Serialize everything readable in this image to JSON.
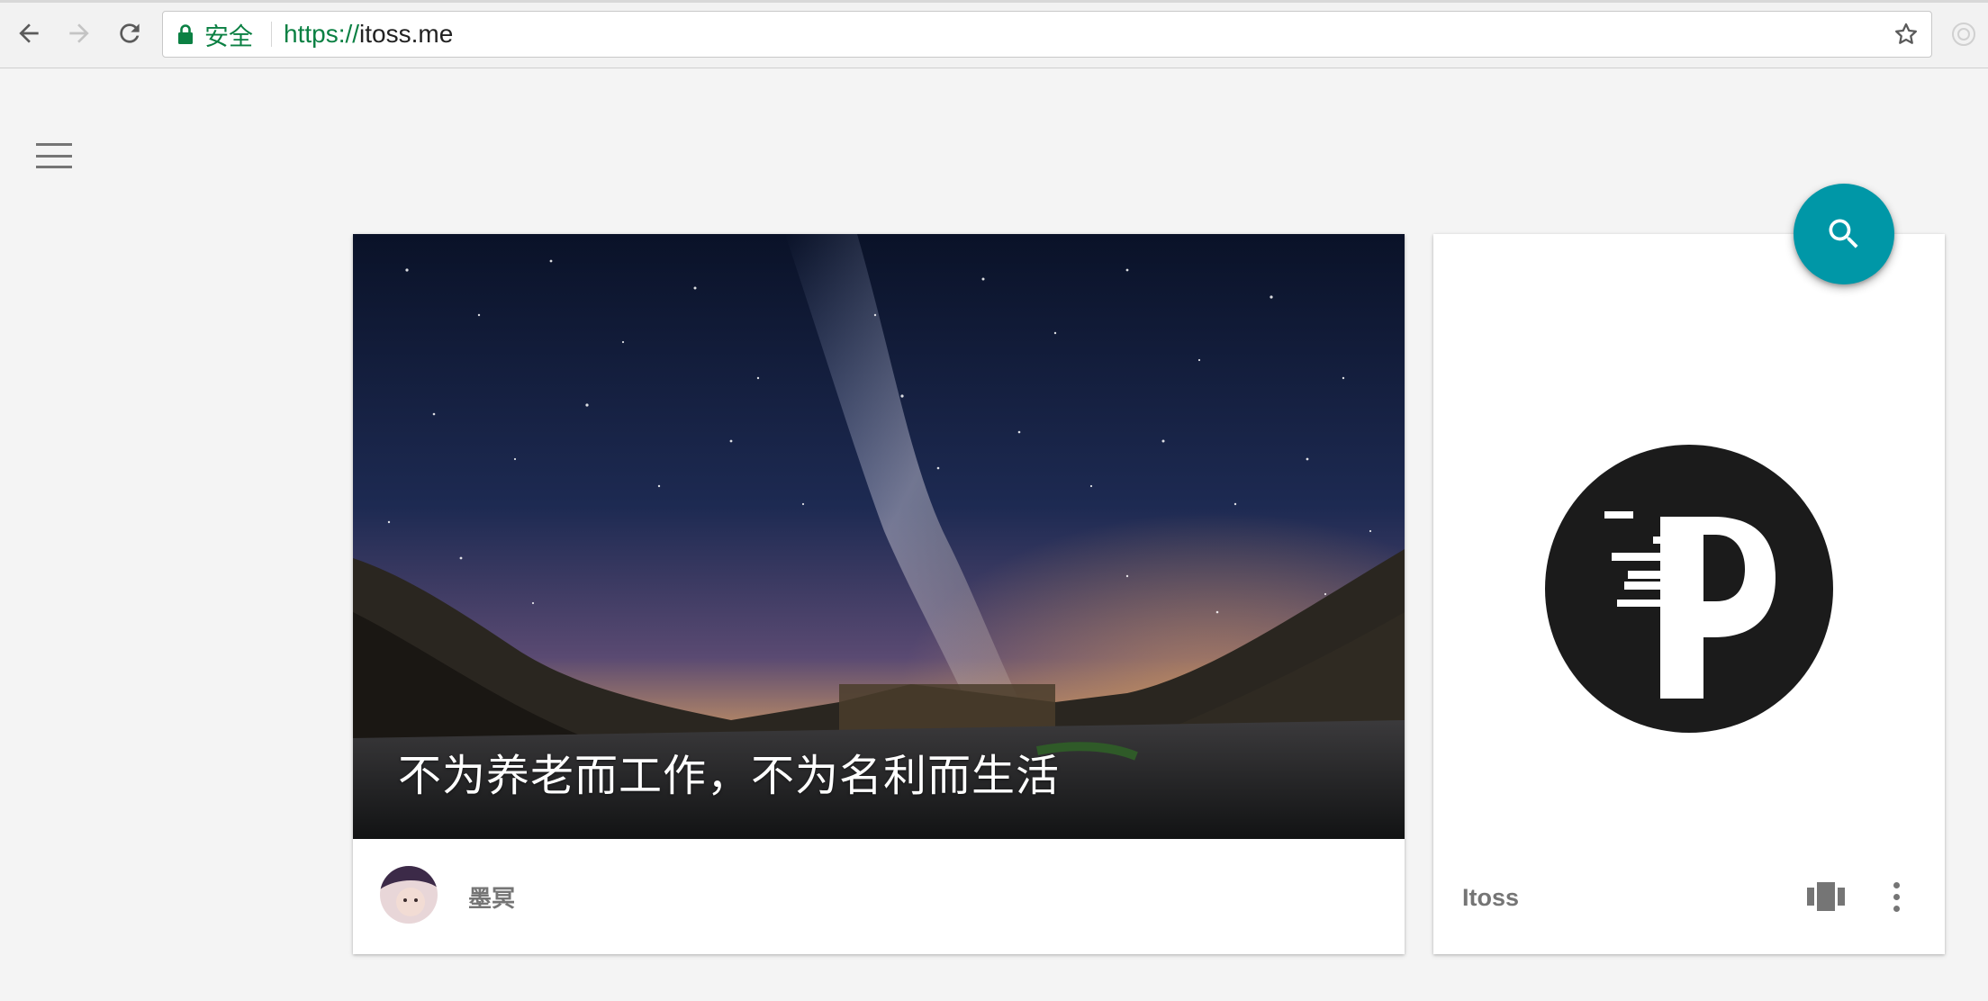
{
  "browser": {
    "secure_label": "安全",
    "url_scheme": "https://",
    "url_host": "itoss.me",
    "icons": [
      "back-icon",
      "forward-icon",
      "reload-icon",
      "lock-icon",
      "star-icon",
      "extension-icon"
    ],
    "secure_color": "#0b8043"
  },
  "page": {
    "menu_icon": "hamburger-menu-icon",
    "fab_icon": "search-icon",
    "fab_color": "#0097a7",
    "main_card": {
      "title": "不为养老而工作，不为名利而生活",
      "author": "墨冥"
    },
    "side_card": {
      "site_name": "Itoss",
      "logo": "itoss-p-logo",
      "actions": [
        "view-carousel-icon",
        "more-vert-icon"
      ]
    }
  }
}
